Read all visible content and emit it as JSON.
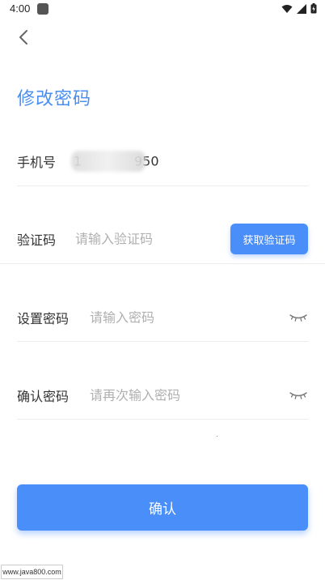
{
  "status_bar": {
    "time": "4:00",
    "icons": [
      "app-notification-icon",
      "wifi-icon",
      "signal-icon",
      "battery-charging-icon"
    ]
  },
  "header": {
    "back_icon": "chevron-left-icon",
    "title": "修改密码"
  },
  "form": {
    "phone": {
      "label": "手机号",
      "value_prefix": "1",
      "value_suffix": "950"
    },
    "verify_code": {
      "label": "验证码",
      "placeholder": "请输入验证码",
      "button_label": "获取验证码"
    },
    "new_password": {
      "label": "设置密码",
      "placeholder": "请输入密码",
      "toggle_icon": "eye-closed-icon"
    },
    "confirm_password": {
      "label": "确认密码",
      "placeholder": "请再次输入密码",
      "toggle_icon": "eye-closed-icon"
    }
  },
  "actions": {
    "confirm_label": "确认"
  },
  "watermark": "www.java800.com",
  "colors": {
    "accent": "#4a8ef9",
    "title": "#4a8ef0",
    "placeholder": "#b0b0b0",
    "divider": "#ececec"
  }
}
